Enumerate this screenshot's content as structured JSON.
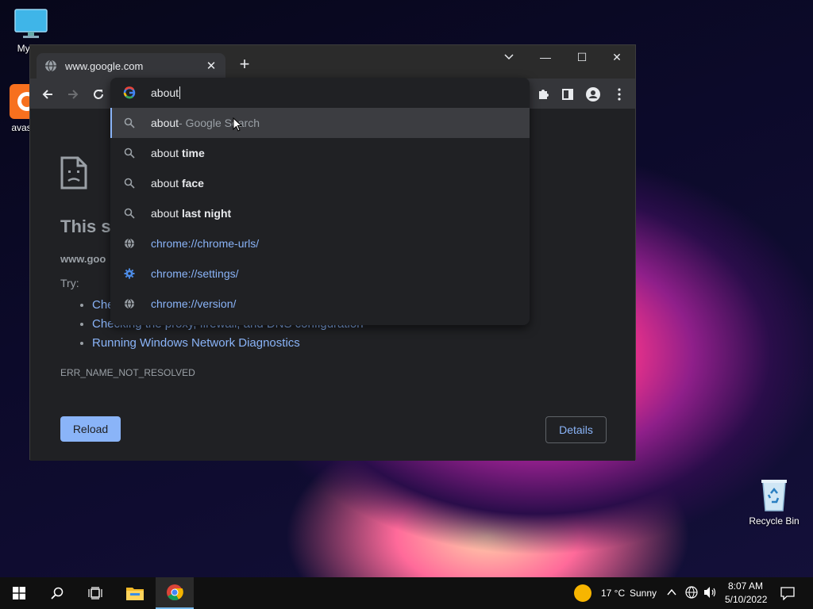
{
  "desktop": {
    "icons": [
      {
        "label": "My Co"
      },
      {
        "label": "avast_"
      },
      {
        "label": "Recycle Bin"
      }
    ]
  },
  "browser": {
    "tab": {
      "title": "www.google.com",
      "close": "✕"
    },
    "new_tab": "+",
    "window_controls": {
      "minimize": "—",
      "maximize": "☐",
      "close": "✕"
    },
    "omnibox": {
      "value": "about",
      "suggestions": [
        {
          "prefix": "about",
          "bold": "",
          "suffix": " - Google Search",
          "icon": "search-icon"
        },
        {
          "prefix": "about ",
          "bold": "time",
          "suffix": "",
          "icon": "search-icon"
        },
        {
          "prefix": "about ",
          "bold": "face",
          "suffix": "",
          "icon": "search-icon"
        },
        {
          "prefix": "about ",
          "bold": "last night",
          "suffix": "",
          "icon": "search-icon"
        },
        {
          "url": "chrome://chrome-urls/",
          "icon": "globe-icon"
        },
        {
          "url": "chrome://settings/",
          "icon": "gear-icon"
        },
        {
          "url": "chrome://version/",
          "icon": "globe-icon"
        }
      ]
    },
    "page": {
      "title": "This si",
      "domain": "www.goo",
      "try_label": "Try:",
      "tips": [
        "Che",
        "Checking the proxy, firewall, and DNS configuration",
        "Running Windows Network Diagnostics"
      ],
      "error_code": "ERR_NAME_NOT_RESOLVED",
      "reload_label": "Reload",
      "details_label": "Details"
    }
  },
  "taskbar": {
    "weather": {
      "temp": "17 °C",
      "condition": "Sunny"
    },
    "time": "8:07 AM",
    "date": "5/10/2022"
  }
}
